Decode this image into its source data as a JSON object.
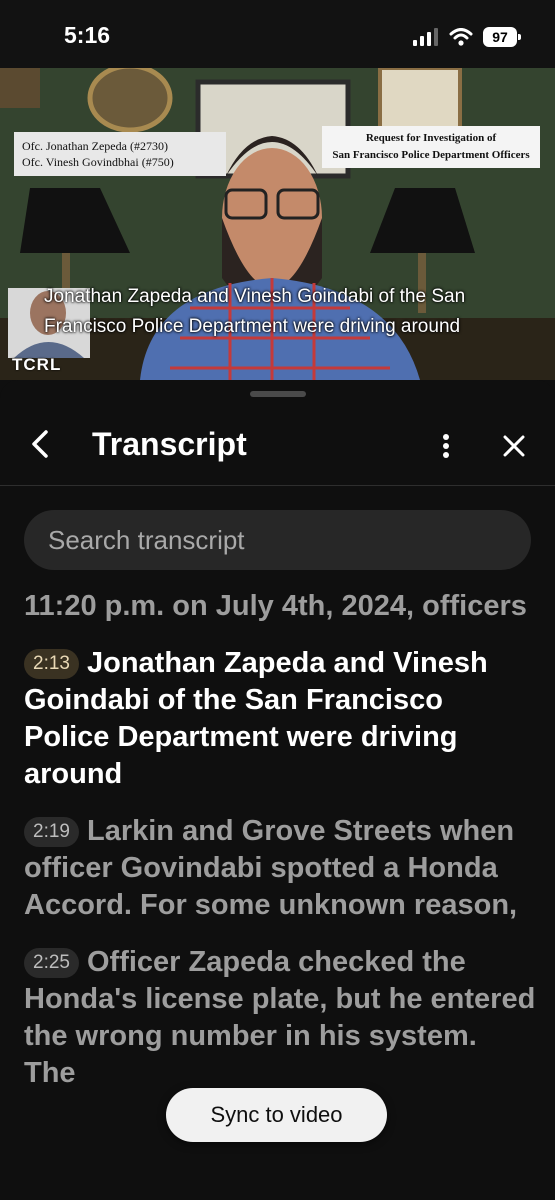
{
  "status": {
    "time": "5:16",
    "battery": "97",
    "icons": [
      "cellular-signal-icon",
      "wifi-icon",
      "battery-icon"
    ]
  },
  "video": {
    "badge_left": [
      "Ofc. Jonathan Zepeda (#2730)",
      "Ofc. Vinesh Govindbhai (#750)"
    ],
    "badge_right": [
      "Request for Investigation of",
      "San Francisco Police Department Officers"
    ],
    "caption_line1": "Jonathan Zapeda and Vinesh Goindabi of the San",
    "caption_line2": "Francisco Police Department were driving around",
    "logo_text": "TCRL"
  },
  "panel": {
    "title": "Transcript",
    "icons": {
      "back": "chevron-left-icon",
      "more": "more-vertical-icon",
      "close": "close-icon"
    }
  },
  "search": {
    "placeholder": "Search transcript",
    "value": ""
  },
  "segments": [
    {
      "timestamp": "",
      "text": "11:20 p.m. on July 4th, 2024, officers",
      "active": false
    },
    {
      "timestamp": "2:13",
      "text": "Jonathan Zapeda and Vinesh Goindabi of the San Francisco Police Department were driving around",
      "active": true
    },
    {
      "timestamp": "2:19",
      "text": "Larkin and Grove Streets when officer Govindabi  spotted a Honda Accord. For some unknown reason,",
      "active": false
    },
    {
      "timestamp": "2:25",
      "text": "Officer Zapeda checked the Honda's license plate,  but he entered the wrong number in his system. The",
      "active": false
    }
  ],
  "sync_button": {
    "label": "Sync to video"
  },
  "colors": {
    "background": "#0f0f0f",
    "active_text": "#ffffff",
    "inactive_text": "#9d9d9d",
    "search_bg": "#272727"
  }
}
